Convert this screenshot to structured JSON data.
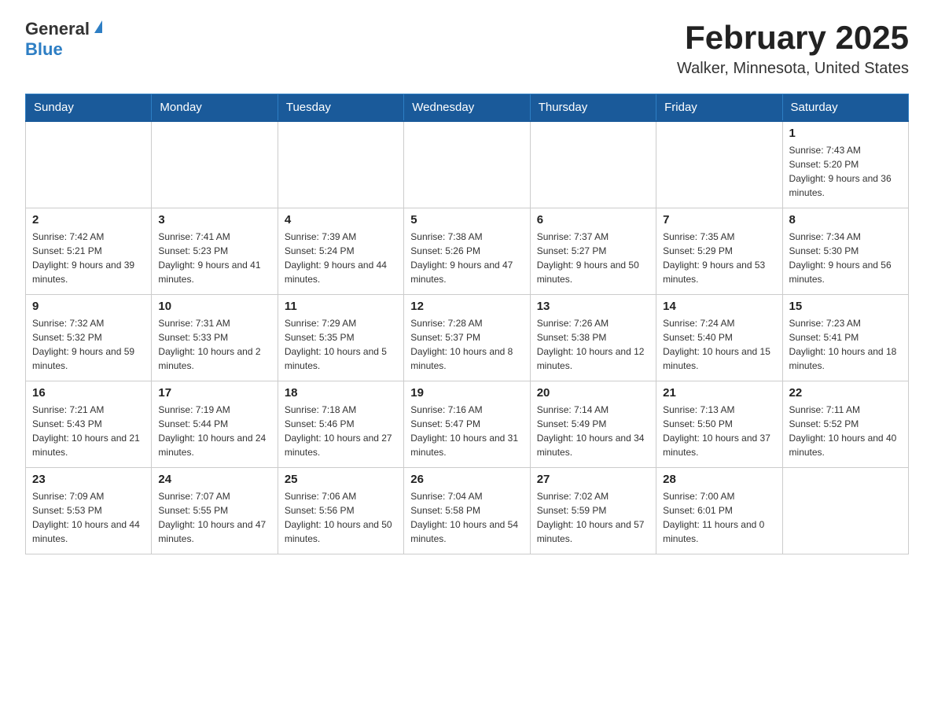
{
  "header": {
    "logo_general": "General",
    "logo_blue": "Blue",
    "title": "February 2025",
    "subtitle": "Walker, Minnesota, United States"
  },
  "days_of_week": [
    "Sunday",
    "Monday",
    "Tuesday",
    "Wednesday",
    "Thursday",
    "Friday",
    "Saturday"
  ],
  "weeks": [
    {
      "cells": [
        {
          "day": null
        },
        {
          "day": null
        },
        {
          "day": null
        },
        {
          "day": null
        },
        {
          "day": null
        },
        {
          "day": null
        },
        {
          "day": "1",
          "sunrise": "Sunrise: 7:43 AM",
          "sunset": "Sunset: 5:20 PM",
          "daylight": "Daylight: 9 hours and 36 minutes."
        }
      ]
    },
    {
      "cells": [
        {
          "day": "2",
          "sunrise": "Sunrise: 7:42 AM",
          "sunset": "Sunset: 5:21 PM",
          "daylight": "Daylight: 9 hours and 39 minutes."
        },
        {
          "day": "3",
          "sunrise": "Sunrise: 7:41 AM",
          "sunset": "Sunset: 5:23 PM",
          "daylight": "Daylight: 9 hours and 41 minutes."
        },
        {
          "day": "4",
          "sunrise": "Sunrise: 7:39 AM",
          "sunset": "Sunset: 5:24 PM",
          "daylight": "Daylight: 9 hours and 44 minutes."
        },
        {
          "day": "5",
          "sunrise": "Sunrise: 7:38 AM",
          "sunset": "Sunset: 5:26 PM",
          "daylight": "Daylight: 9 hours and 47 minutes."
        },
        {
          "day": "6",
          "sunrise": "Sunrise: 7:37 AM",
          "sunset": "Sunset: 5:27 PM",
          "daylight": "Daylight: 9 hours and 50 minutes."
        },
        {
          "day": "7",
          "sunrise": "Sunrise: 7:35 AM",
          "sunset": "Sunset: 5:29 PM",
          "daylight": "Daylight: 9 hours and 53 minutes."
        },
        {
          "day": "8",
          "sunrise": "Sunrise: 7:34 AM",
          "sunset": "Sunset: 5:30 PM",
          "daylight": "Daylight: 9 hours and 56 minutes."
        }
      ]
    },
    {
      "cells": [
        {
          "day": "9",
          "sunrise": "Sunrise: 7:32 AM",
          "sunset": "Sunset: 5:32 PM",
          "daylight": "Daylight: 9 hours and 59 minutes."
        },
        {
          "day": "10",
          "sunrise": "Sunrise: 7:31 AM",
          "sunset": "Sunset: 5:33 PM",
          "daylight": "Daylight: 10 hours and 2 minutes."
        },
        {
          "day": "11",
          "sunrise": "Sunrise: 7:29 AM",
          "sunset": "Sunset: 5:35 PM",
          "daylight": "Daylight: 10 hours and 5 minutes."
        },
        {
          "day": "12",
          "sunrise": "Sunrise: 7:28 AM",
          "sunset": "Sunset: 5:37 PM",
          "daylight": "Daylight: 10 hours and 8 minutes."
        },
        {
          "day": "13",
          "sunrise": "Sunrise: 7:26 AM",
          "sunset": "Sunset: 5:38 PM",
          "daylight": "Daylight: 10 hours and 12 minutes."
        },
        {
          "day": "14",
          "sunrise": "Sunrise: 7:24 AM",
          "sunset": "Sunset: 5:40 PM",
          "daylight": "Daylight: 10 hours and 15 minutes."
        },
        {
          "day": "15",
          "sunrise": "Sunrise: 7:23 AM",
          "sunset": "Sunset: 5:41 PM",
          "daylight": "Daylight: 10 hours and 18 minutes."
        }
      ]
    },
    {
      "cells": [
        {
          "day": "16",
          "sunrise": "Sunrise: 7:21 AM",
          "sunset": "Sunset: 5:43 PM",
          "daylight": "Daylight: 10 hours and 21 minutes."
        },
        {
          "day": "17",
          "sunrise": "Sunrise: 7:19 AM",
          "sunset": "Sunset: 5:44 PM",
          "daylight": "Daylight: 10 hours and 24 minutes."
        },
        {
          "day": "18",
          "sunrise": "Sunrise: 7:18 AM",
          "sunset": "Sunset: 5:46 PM",
          "daylight": "Daylight: 10 hours and 27 minutes."
        },
        {
          "day": "19",
          "sunrise": "Sunrise: 7:16 AM",
          "sunset": "Sunset: 5:47 PM",
          "daylight": "Daylight: 10 hours and 31 minutes."
        },
        {
          "day": "20",
          "sunrise": "Sunrise: 7:14 AM",
          "sunset": "Sunset: 5:49 PM",
          "daylight": "Daylight: 10 hours and 34 minutes."
        },
        {
          "day": "21",
          "sunrise": "Sunrise: 7:13 AM",
          "sunset": "Sunset: 5:50 PM",
          "daylight": "Daylight: 10 hours and 37 minutes."
        },
        {
          "day": "22",
          "sunrise": "Sunrise: 7:11 AM",
          "sunset": "Sunset: 5:52 PM",
          "daylight": "Daylight: 10 hours and 40 minutes."
        }
      ]
    },
    {
      "cells": [
        {
          "day": "23",
          "sunrise": "Sunrise: 7:09 AM",
          "sunset": "Sunset: 5:53 PM",
          "daylight": "Daylight: 10 hours and 44 minutes."
        },
        {
          "day": "24",
          "sunrise": "Sunrise: 7:07 AM",
          "sunset": "Sunset: 5:55 PM",
          "daylight": "Daylight: 10 hours and 47 minutes."
        },
        {
          "day": "25",
          "sunrise": "Sunrise: 7:06 AM",
          "sunset": "Sunset: 5:56 PM",
          "daylight": "Daylight: 10 hours and 50 minutes."
        },
        {
          "day": "26",
          "sunrise": "Sunrise: 7:04 AM",
          "sunset": "Sunset: 5:58 PM",
          "daylight": "Daylight: 10 hours and 54 minutes."
        },
        {
          "day": "27",
          "sunrise": "Sunrise: 7:02 AM",
          "sunset": "Sunset: 5:59 PM",
          "daylight": "Daylight: 10 hours and 57 minutes."
        },
        {
          "day": "28",
          "sunrise": "Sunrise: 7:00 AM",
          "sunset": "Sunset: 6:01 PM",
          "daylight": "Daylight: 11 hours and 0 minutes."
        },
        {
          "day": null
        }
      ]
    }
  ]
}
